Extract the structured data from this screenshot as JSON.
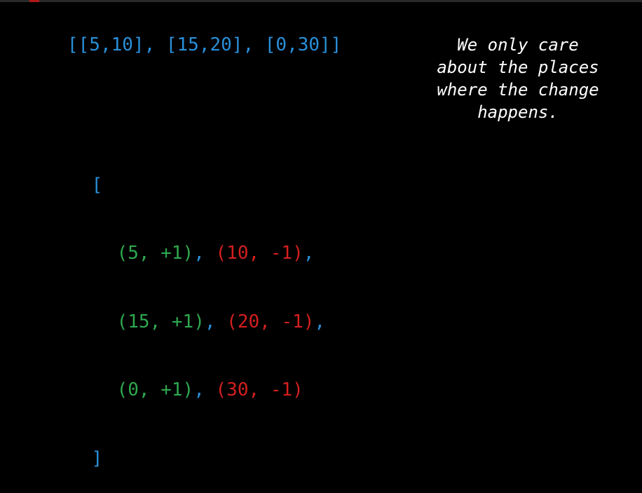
{
  "colors": {
    "background": "#000000",
    "bracket_blue": "#2a8fd8",
    "start_green": "#2ea84f",
    "end_red": "#d41f1f",
    "text_white": "#ffffff"
  },
  "intervals_text": "[[5,10], [15,20], [0,30]]",
  "code": {
    "open_bracket": "[",
    "close_bracket": "]",
    "rows": [
      {
        "start": "(5, +1)",
        "sep": ", ",
        "end": "(10, -1)",
        "tail": ","
      },
      {
        "start": "(15, +1)",
        "sep": ", ",
        "end": "(20, -1)",
        "tail": ","
      },
      {
        "start": "(0, +1)",
        "sep": ", ",
        "end": "(30, -1)",
        "tail": ""
      }
    ]
  },
  "note_lines": [
    "We only care",
    "about the places",
    "where the change",
    "happens."
  ]
}
